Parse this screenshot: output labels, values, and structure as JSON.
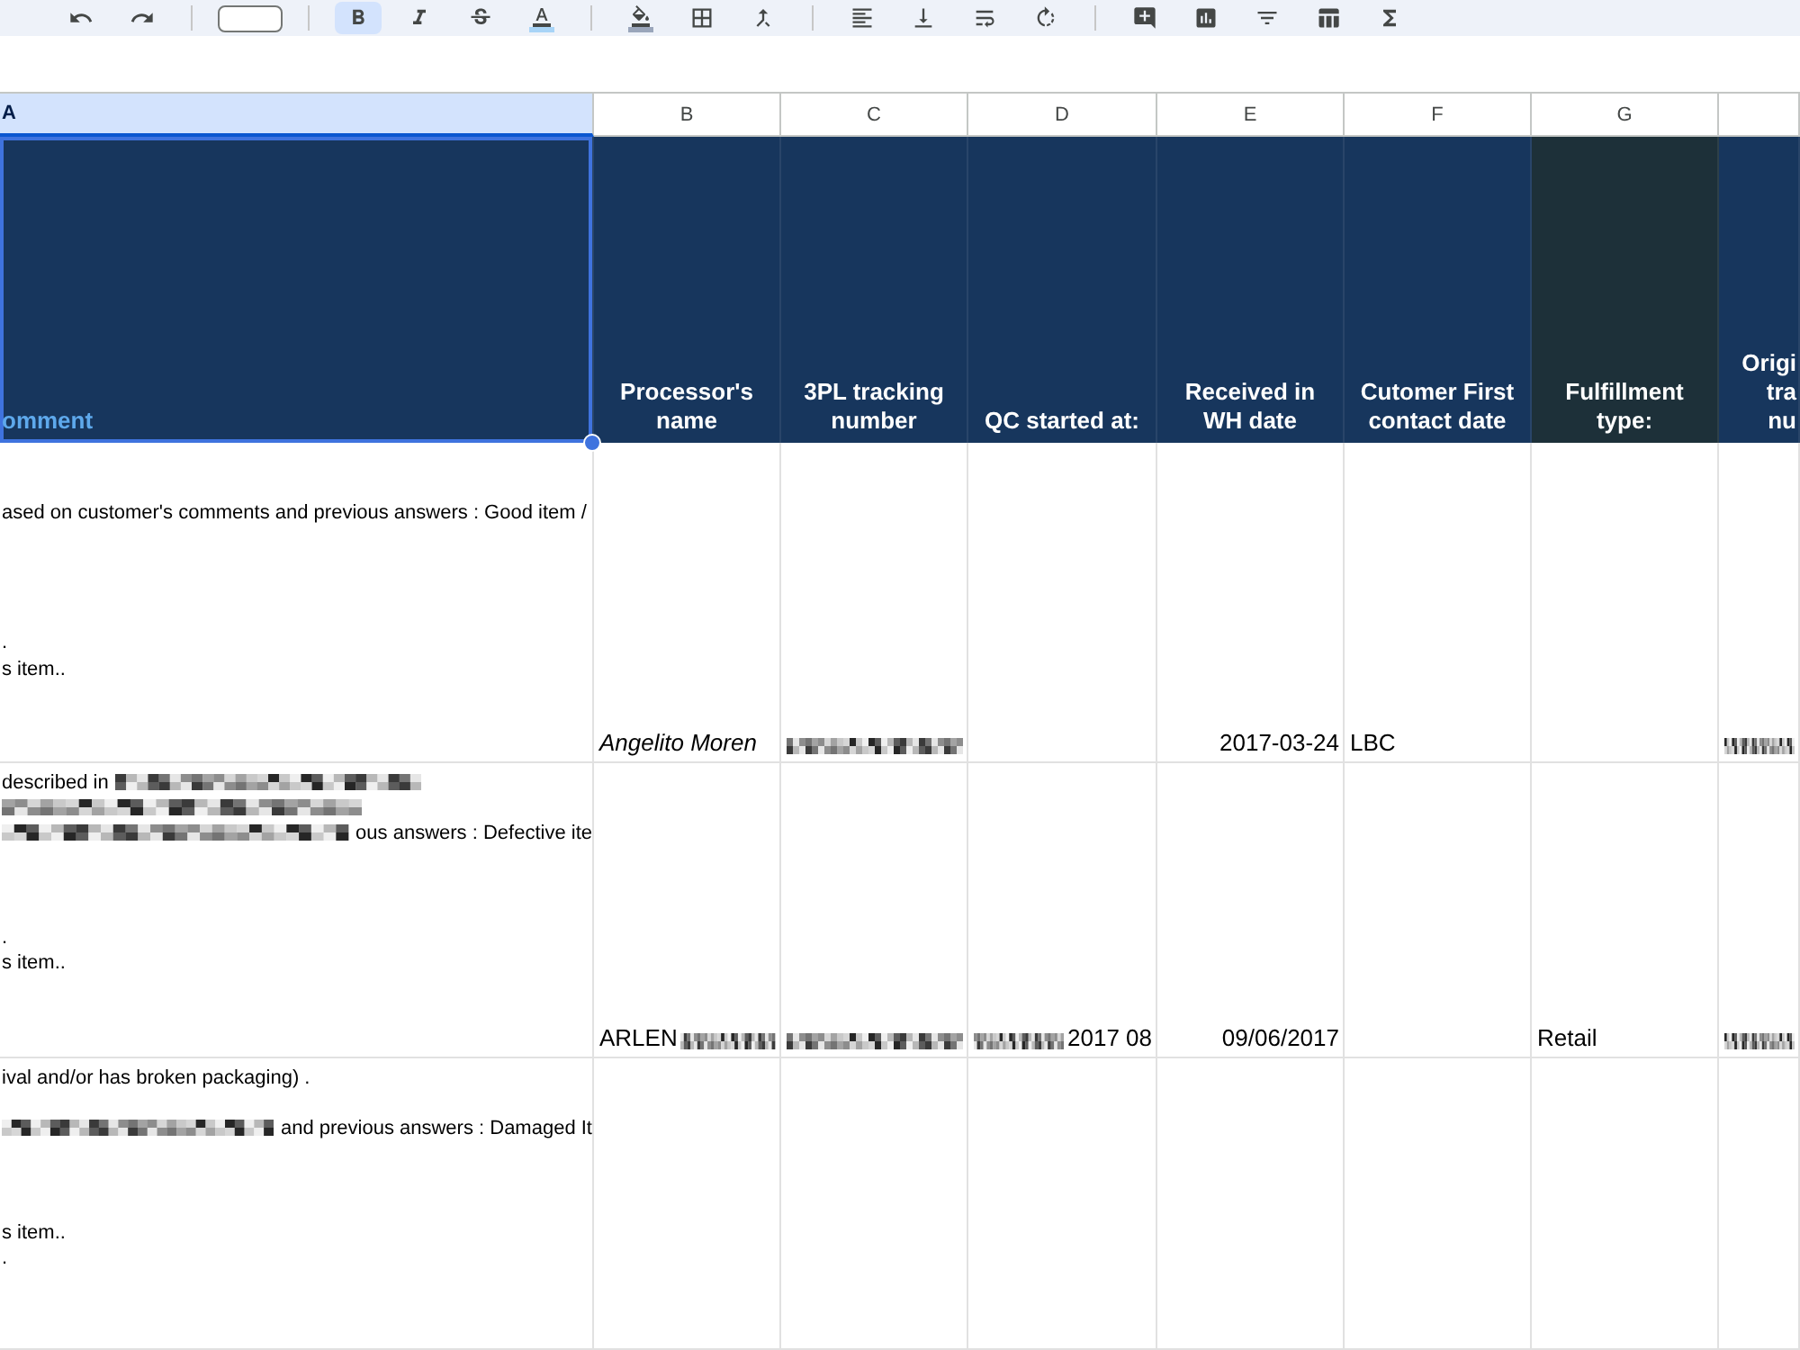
{
  "toolbar": {
    "tools": [
      {
        "kind": "undo",
        "selected": false
      },
      {
        "kind": "redo",
        "selected": false
      },
      {
        "kind": "separator"
      },
      {
        "kind": "font_size"
      },
      {
        "kind": "separator"
      },
      {
        "kind": "bold",
        "selected": true
      },
      {
        "kind": "italic",
        "selected": false
      },
      {
        "kind": "strikethrough",
        "selected": false
      },
      {
        "kind": "text_color",
        "selected": false,
        "color": "#a8d4f7"
      },
      {
        "kind": "separator"
      },
      {
        "kind": "fill_color",
        "selected": false,
        "color": "#9aa6bb"
      },
      {
        "kind": "borders",
        "selected": false
      },
      {
        "kind": "merge",
        "selected": false
      },
      {
        "kind": "separator"
      },
      {
        "kind": "align",
        "selected": false
      },
      {
        "kind": "valign",
        "selected": false
      },
      {
        "kind": "wrap",
        "selected": false
      },
      {
        "kind": "rotate",
        "selected": false
      },
      {
        "kind": "separator"
      },
      {
        "kind": "comment",
        "selected": false
      },
      {
        "kind": "chart",
        "selected": false
      },
      {
        "kind": "filter",
        "selected": false
      },
      {
        "kind": "table",
        "selected": false
      },
      {
        "kind": "functions",
        "selected": false
      }
    ]
  },
  "columns": [
    {
      "letter": "A",
      "selected": true
    },
    {
      "letter": "B",
      "selected": false
    },
    {
      "letter": "C",
      "selected": false
    },
    {
      "letter": "D",
      "selected": false
    },
    {
      "letter": "E",
      "selected": false
    },
    {
      "letter": "F",
      "selected": false
    },
    {
      "letter": "G",
      "selected": false
    }
  ],
  "header_row": {
    "cells": [
      {
        "lines": [
          "omment"
        ],
        "color": "#17365d",
        "kind": "accent",
        "selected": true
      },
      {
        "lines": [
          "Processor's",
          "name"
        ],
        "color": "#17365d",
        "kind": "plain",
        "selected": false
      },
      {
        "lines": [
          "3PL tracking",
          "number"
        ],
        "color": "#17365d",
        "kind": "plain",
        "selected": false
      },
      {
        "lines": [
          "QC started at:"
        ],
        "color": "#17365d",
        "kind": "plain",
        "selected": false
      },
      {
        "lines": [
          "Received in",
          "WH date"
        ],
        "color": "#17365d",
        "kind": "plain",
        "selected": false
      },
      {
        "lines": [
          "Cutomer First",
          "contact date"
        ],
        "color": "#17365d",
        "kind": "plain",
        "selected": false
      },
      {
        "lines": [
          "Fulfillment",
          "type:"
        ],
        "color": "#1d3039",
        "kind": "plain",
        "selected": false
      },
      {
        "lines": [
          "Origi",
          "tra",
          "nu"
        ],
        "color": "#17365d",
        "kind": "plain",
        "selected": false
      }
    ]
  },
  "rows": [
    {
      "cells": [
        {
          "kind": "multiline",
          "lines": [
            {
              "kind": "blank"
            },
            {
              "kind": "blank"
            },
            {
              "kind": "text",
              "text": "ased on customer's comments and previous answers : Good item /"
            },
            {
              "kind": "blank"
            },
            {
              "kind": "blank"
            },
            {
              "kind": "blank"
            },
            {
              "kind": "blank"
            },
            {
              "kind": "text",
              "text": "."
            },
            {
              "kind": "text",
              "text": "s item.."
            }
          ]
        },
        {
          "kind": "text",
          "text": "Angelito Moren",
          "italic": true
        },
        {
          "kind": "redacted"
        },
        {
          "kind": "empty"
        },
        {
          "kind": "date",
          "text": "2017-03-24"
        },
        {
          "kind": "text",
          "text": "LBC"
        },
        {
          "kind": "empty"
        },
        {
          "kind": "redacted"
        }
      ]
    },
    {
      "cells": [
        {
          "kind": "multiline",
          "lines": [
            {
              "kind": "text_redacted",
              "text": "described in"
            },
            {
              "kind": "redacted"
            },
            {
              "kind": "redacted_text",
              "text": "ous answers : Defective ite"
            },
            {
              "kind": "blank"
            },
            {
              "kind": "blank"
            },
            {
              "kind": "blank"
            },
            {
              "kind": "text",
              "text": "."
            },
            {
              "kind": "text",
              "text": "s item.."
            }
          ]
        },
        {
          "kind": "text_redacted",
          "text": "ARLEN"
        },
        {
          "kind": "redacted"
        },
        {
          "kind": "redacted_text",
          "text": "2017 08"
        },
        {
          "kind": "date",
          "text": "09/06/2017"
        },
        {
          "kind": "empty"
        },
        {
          "kind": "text",
          "text": "Retail"
        },
        {
          "kind": "redacted"
        }
      ]
    },
    {
      "cells": [
        {
          "kind": "multiline",
          "lines": [
            {
              "kind": "text",
              "text": "ival and/or has broken packaging) ."
            },
            {
              "kind": "blank"
            },
            {
              "kind": "redacted_text",
              "text": "and previous answers : Damaged It"
            },
            {
              "kind": "blank"
            },
            {
              "kind": "blank"
            },
            {
              "kind": "blank"
            },
            {
              "kind": "text",
              "text": "s item.."
            },
            {
              "kind": "text",
              "text": "."
            }
          ]
        },
        {
          "kind": "empty"
        },
        {
          "kind": "empty"
        },
        {
          "kind": "empty"
        },
        {
          "kind": "empty"
        },
        {
          "kind": "empty"
        },
        {
          "kind": "empty"
        },
        {
          "kind": "empty"
        }
      ]
    }
  ]
}
